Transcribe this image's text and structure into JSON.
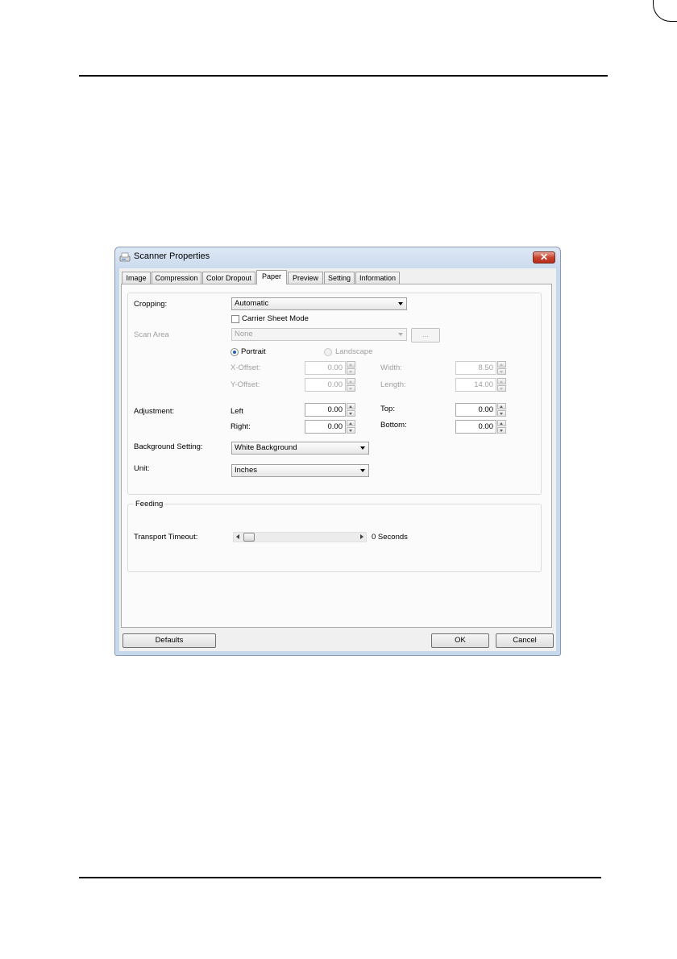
{
  "window": {
    "title": "Scanner Properties"
  },
  "tabs": [
    "Image",
    "Compression",
    "Color Dropout",
    "Paper",
    "Preview",
    "Setting",
    "Information"
  ],
  "paper": {
    "cropping": {
      "label": "Cropping:",
      "value": "Automatic"
    },
    "carrier_sheet": {
      "label": "Carrier Sheet Mode",
      "checked": false
    },
    "scan_area": {
      "label": "Scan Area",
      "value": "None",
      "browse_label": "..."
    },
    "orientation": {
      "portrait": "Portrait",
      "landscape": "Landscape",
      "selected": "Portrait"
    },
    "x_offset": {
      "label": "X-Offset:",
      "value": "0.00"
    },
    "y_offset": {
      "label": "Y-Offset:",
      "value": "0.00"
    },
    "width": {
      "label": "Width:",
      "value": "8.50"
    },
    "length": {
      "label": "Length:",
      "value": "14.00"
    },
    "adjustment": {
      "label": "Adjustment:",
      "left": {
        "label": "Left",
        "value": "0.00"
      },
      "right": {
        "label": "Right:",
        "value": "0.00"
      },
      "top": {
        "label": "Top:",
        "value": "0.00"
      },
      "bottom": {
        "label": "Bottom:",
        "value": "0.00"
      }
    },
    "background": {
      "label": "Background Setting:",
      "value": "White Background"
    },
    "unit": {
      "label": "Unit:",
      "value": "Inches"
    }
  },
  "feeding": {
    "title": "Feeding",
    "transport_timeout": {
      "label": "Transport Timeout:",
      "value_text": "0 Seconds",
      "slider_fraction": 0
    }
  },
  "buttons": {
    "defaults": "Defaults",
    "ok": "OK",
    "cancel": "Cancel"
  }
}
